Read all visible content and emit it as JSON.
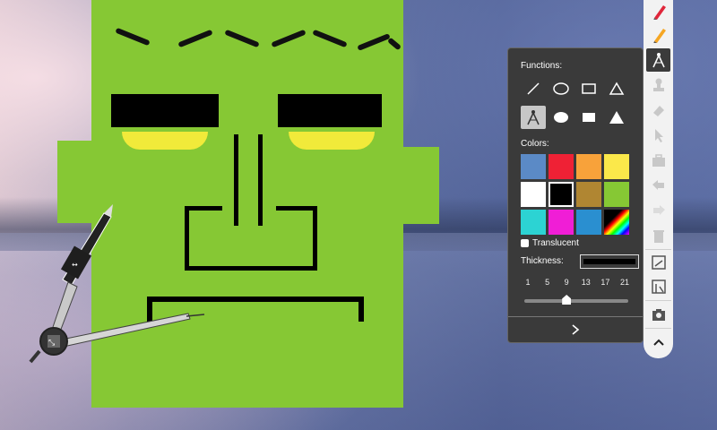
{
  "drawing": {
    "face_color": "#86c834",
    "eye_color": "#f1ea3a",
    "stroke_color": "#000000"
  },
  "compass_tool": {
    "icon": "compass-icon",
    "handle_icon": "move-icon",
    "adjust_icon": "resize-arrows-icon"
  },
  "panel": {
    "functions_label": "Functions:",
    "functions": [
      {
        "name": "line",
        "icon": "line-icon"
      },
      {
        "name": "ellipse",
        "icon": "ellipse-outline-icon"
      },
      {
        "name": "rectangle",
        "icon": "rectangle-outline-icon"
      },
      {
        "name": "triangle",
        "icon": "triangle-outline-icon"
      },
      {
        "name": "compass",
        "icon": "compass-icon",
        "selected": true
      },
      {
        "name": "filled-ellipse",
        "icon": "ellipse-filled-icon"
      },
      {
        "name": "filled-rectangle",
        "icon": "rectangle-filled-icon"
      },
      {
        "name": "filled-triangle",
        "icon": "triangle-filled-icon"
      }
    ],
    "colors_label": "Colors:",
    "colors": [
      "#5b8ac6",
      "#ef2135",
      "#f8a23a",
      "#fbe84a",
      "#ffffff",
      "#000000",
      "#b08632",
      "#86c834",
      "#2cd3d3",
      "#f01ed6",
      "#2a8fd0",
      "rainbow"
    ],
    "selected_color": "#000000",
    "translucent_label": "Translucent",
    "translucent_checked": false,
    "thickness_label": "Thickness:",
    "thickness_ticks": [
      "1",
      "5",
      "9",
      "13",
      "17",
      "21"
    ],
    "thickness_value": 9,
    "next_icon": "chevron-right-icon"
  },
  "toolbar": {
    "items": [
      {
        "name": "pen-red",
        "icon": "pen-icon"
      },
      {
        "name": "highlighter",
        "icon": "highlighter-icon"
      },
      {
        "name": "shapes",
        "icon": "compass-icon",
        "active": true
      },
      {
        "name": "stamp",
        "icon": "stamp-icon"
      },
      {
        "name": "eraser",
        "icon": "eraser-icon"
      },
      {
        "name": "select",
        "icon": "pointer-icon"
      },
      {
        "name": "toolbox",
        "icon": "toolbox-icon"
      },
      {
        "name": "undo",
        "icon": "undo-icon"
      },
      {
        "name": "redo",
        "icon": "redo-icon"
      },
      {
        "name": "trash",
        "icon": "trash-icon"
      },
      {
        "name": "board",
        "icon": "whiteboard-icon"
      },
      {
        "name": "desktop-draw",
        "icon": "desktop-draw-icon"
      },
      {
        "name": "screenshot",
        "icon": "camera-icon"
      },
      {
        "name": "collapse",
        "icon": "chevron-up-icon"
      }
    ]
  }
}
